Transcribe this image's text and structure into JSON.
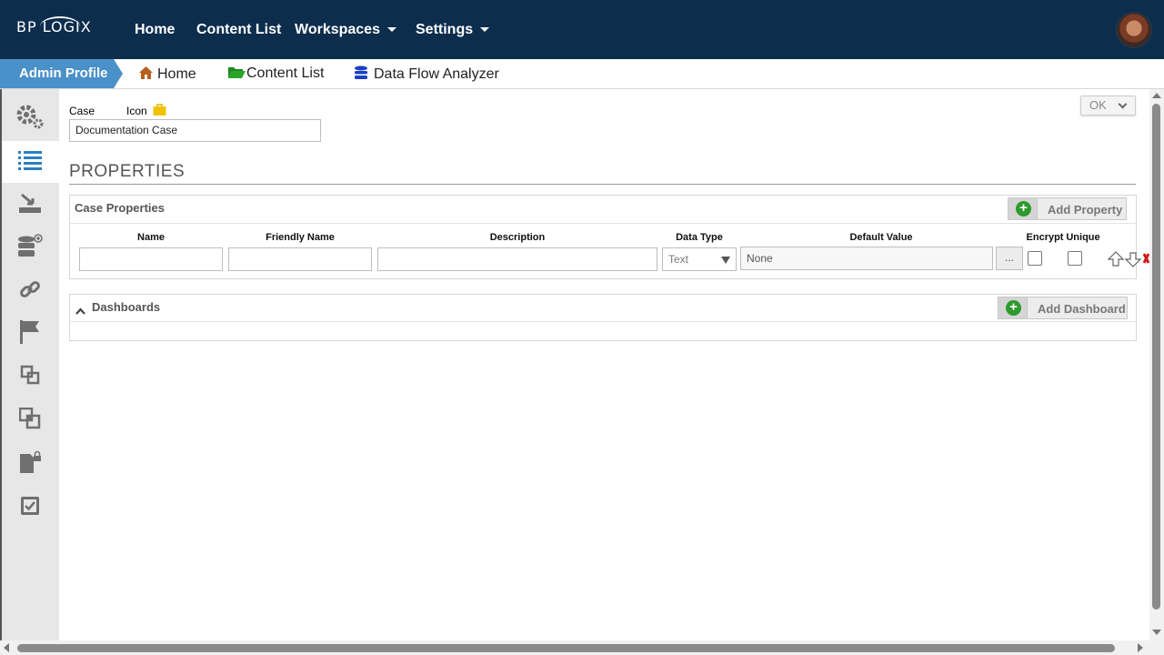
{
  "topnav": {
    "logo": "BP LOGIX",
    "items": [
      {
        "label": "Home"
      },
      {
        "label": "Content List"
      },
      {
        "label": "Workspaces"
      },
      {
        "label": "Settings"
      }
    ]
  },
  "breadcrumb": {
    "current": "Admin Profile",
    "items": [
      {
        "label": "Home",
        "icon": "house-icon"
      },
      {
        "label": "Content List",
        "icon": "folder-icon"
      },
      {
        "label": "Data Flow Analyzer",
        "icon": "database-icon"
      }
    ]
  },
  "sidebar": {
    "items": [
      {
        "icon": "gears-icon"
      },
      {
        "icon": "list-icon",
        "active": true
      },
      {
        "icon": "import-icon"
      },
      {
        "icon": "database-add-icon"
      },
      {
        "icon": "link-icon"
      },
      {
        "icon": "flag-icon"
      },
      {
        "icon": "copy-icon"
      },
      {
        "icon": "copy-alt-icon"
      },
      {
        "icon": "document-lock-icon"
      },
      {
        "icon": "checkbox-icon"
      }
    ]
  },
  "case": {
    "label": "Case",
    "icon_label": "Icon",
    "name_value": "Documentation Case"
  },
  "ok_button": "OK",
  "properties": {
    "title": "PROPERTIES",
    "case_properties": {
      "title": "Case Properties",
      "add_button": "Add Property",
      "columns": [
        "Name",
        "Friendly Name",
        "Description",
        "Data Type",
        "Default Value",
        "Encrypt",
        "Unique"
      ],
      "row": {
        "name": "",
        "friendly_name": "",
        "description": "",
        "data_type": "Text",
        "default_value": "None",
        "browse_label": "...",
        "encrypt": false,
        "unique": false
      }
    },
    "dashboards": {
      "title": "Dashboards",
      "add_button": "Add Dashboard"
    }
  },
  "colors": {
    "nav_bg": "#0d2d4d",
    "breadcrumb_active": "#4a90c9",
    "add_green": "#2c9a2c",
    "sidebar_bg": "#e7e7e7"
  }
}
